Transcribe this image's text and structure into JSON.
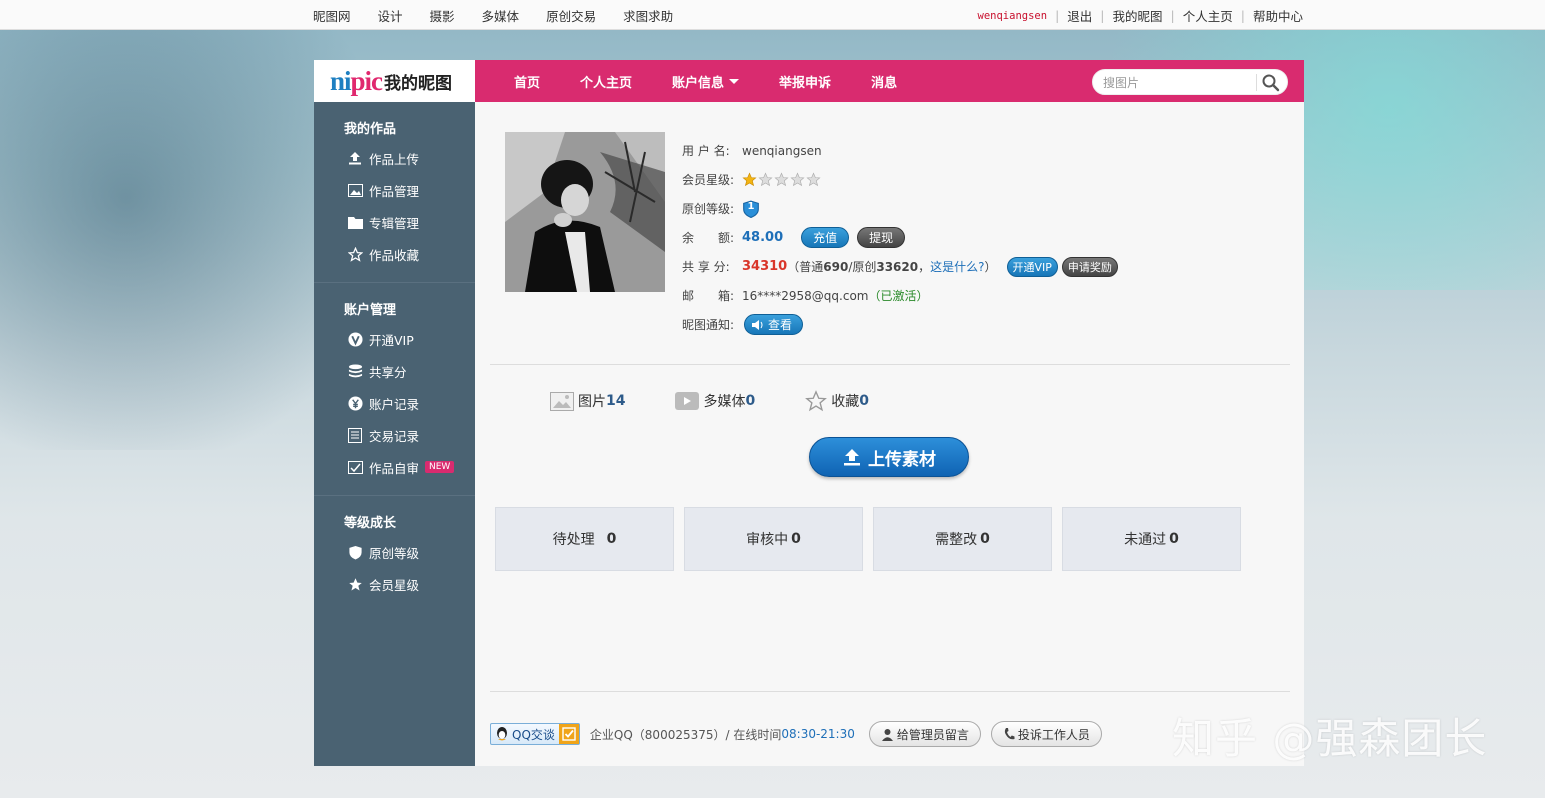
{
  "topbar": {
    "left_links": [
      "昵图网",
      "设计",
      "摄影",
      "多媒体",
      "原创交易",
      "求图求助"
    ],
    "username": "wenqiangsen",
    "logout": "退出",
    "my_nipic": "我的昵图",
    "homepage": "个人主页",
    "help": "帮助中心"
  },
  "logo": {
    "brand_a": "ni",
    "brand_b": "pic",
    "title": "我的昵图"
  },
  "nav": {
    "items": [
      {
        "label": "首页"
      },
      {
        "label": "个人主页"
      },
      {
        "label": "账户信息",
        "has_caret": true
      },
      {
        "label": "举报申诉"
      },
      {
        "label": "消息"
      }
    ],
    "search_placeholder": "搜图片"
  },
  "sidebar": {
    "groups": [
      {
        "title": "我的作品",
        "items": [
          {
            "label": "作品上传",
            "icon": "upload-icon"
          },
          {
            "label": "作品管理",
            "icon": "image-icon"
          },
          {
            "label": "专辑管理",
            "icon": "folder-icon"
          },
          {
            "label": "作品收藏",
            "icon": "star-outline-icon"
          }
        ]
      },
      {
        "title": "账户管理",
        "items": [
          {
            "label": "开通VIP",
            "icon": "vip-icon"
          },
          {
            "label": "共享分",
            "icon": "database-icon"
          },
          {
            "label": "账户记录",
            "icon": "yen-icon"
          },
          {
            "label": "交易记录",
            "icon": "ledger-icon"
          },
          {
            "label": "作品自审",
            "icon": "review-icon",
            "badge": "NEW"
          }
        ]
      },
      {
        "title": "等级成长",
        "items": [
          {
            "label": "原创等级",
            "icon": "shield-icon"
          },
          {
            "label": "会员星级",
            "icon": "star-icon"
          }
        ]
      }
    ]
  },
  "profile": {
    "username_label": "用 户 名:",
    "username": "wenqiangsen",
    "member_level_label": "会员星级:",
    "member_stars": 1,
    "member_stars_max": 5,
    "original_level_label": "原创等级:",
    "original_level": "1",
    "balance_label": "余　　额:",
    "balance": "48.00",
    "recharge": "充值",
    "withdraw": "提现",
    "share_label": "共 享 分:",
    "share_total": "34310",
    "share_detail_a": "（普通",
    "share_normal": "690",
    "share_detail_b": "/原创",
    "share_original": "33620",
    "share_detail_c": "，",
    "share_what": "这是什么?",
    "share_detail_d": "）",
    "open_vip": "开通VIP",
    "apply_reward": "申请奖励",
    "email_label": "邮　　箱:",
    "email": "16****2958@qq.com",
    "email_status": "（已激活）",
    "notice_label": "昵图通知:",
    "notice_button": "查看"
  },
  "stats": [
    {
      "label": "图片",
      "value": "14",
      "icon": "picture-icon"
    },
    {
      "label": "多媒体",
      "value": "0",
      "icon": "video-icon"
    },
    {
      "label": "收藏",
      "value": "0",
      "icon": "star-outline-icon"
    }
  ],
  "upload_button": "上传素材",
  "status_boxes": [
    {
      "label": "待处理",
      "value": "0"
    },
    {
      "label": "审核中",
      "value": "0"
    },
    {
      "label": "需整改",
      "value": "0"
    },
    {
      "label": "未通过",
      "value": "0"
    }
  ],
  "footer": {
    "qq_label": "QQ交谈",
    "corp_qq": "企业QQ（800025375）/ 在线时间",
    "hours": "08:30-21:30",
    "message_admin": "给管理员留言",
    "complain": "投诉工作人员"
  },
  "watermark": "知乎 @强森团长",
  "colors": {
    "nav_pink": "#d92b6f",
    "sidebar": "#4a6272",
    "accent_blue": "#1e6fb8",
    "share_red": "#d9362a"
  }
}
